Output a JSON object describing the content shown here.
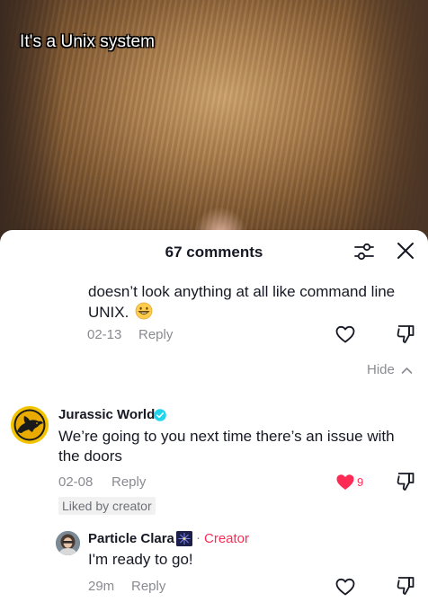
{
  "video": {
    "caption": "It's a Unix system"
  },
  "comments_sheet": {
    "title": "67 comments",
    "icons": {
      "filter": "sliders-icon",
      "close": "close-icon"
    }
  },
  "comments": [
    {
      "text": "doesn’t look anything at all like command line UNIX.",
      "emoji": "grinning-face-emoji",
      "date": "02-13",
      "reply_label": "Reply",
      "liked": false
    }
  ],
  "hide_label": "Hide",
  "comment_2": {
    "author": "Jurassic World",
    "verified": true,
    "text": "We’re going to you next time there’s an issue with the doors",
    "date": "02-08",
    "reply_label": "Reply",
    "like_count": "9",
    "liked": true,
    "liked_by_label": "Liked by creator"
  },
  "comment_3": {
    "author": "Particle Clara",
    "author_emoji": "fireworks-emoji",
    "separator": "·",
    "role_label": "Creator",
    "text": "I'm ready to go!",
    "date": "29m",
    "reply_label": "Reply",
    "liked": false
  },
  "colors": {
    "accent": "#fe2c55",
    "text_primary": "#161823",
    "text_secondary": "#8a8b91",
    "verified": "#20d5ec"
  }
}
